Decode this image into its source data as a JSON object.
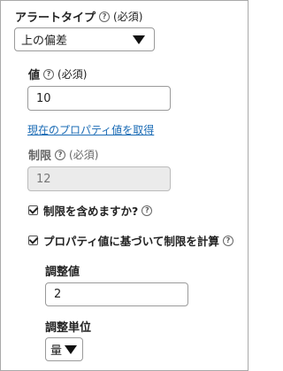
{
  "alert_type": {
    "label": "アラートタイプ",
    "required": "(必須)",
    "selected": "上の偏差"
  },
  "value_field": {
    "label": "値",
    "required": "(必須)",
    "value": "10"
  },
  "get_property_link": "現在のプロパティ値を取得",
  "limit_field": {
    "label": "制限",
    "required": "(必須)",
    "value": "12"
  },
  "include_limit": {
    "label": "制限を含めますか?",
    "checked": true
  },
  "calc_limit": {
    "label": "プロパティ値に基づいて制限を計算",
    "checked": true
  },
  "adjust_value": {
    "label": "調整値",
    "value": "2"
  },
  "adjust_unit": {
    "label": "調整単位",
    "selected": "量"
  },
  "icons": {
    "help": "?"
  }
}
